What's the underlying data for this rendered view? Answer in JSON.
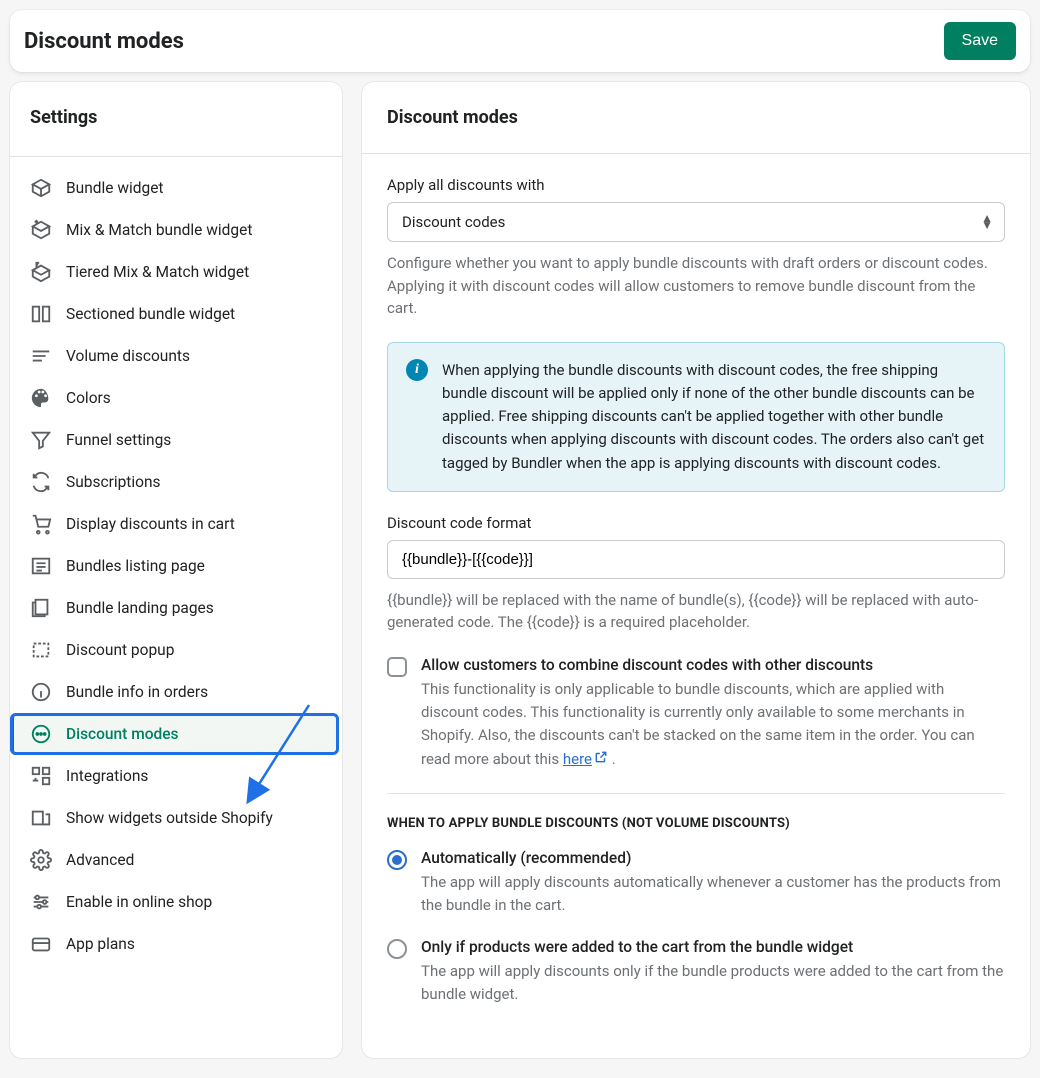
{
  "header": {
    "title": "Discount modes",
    "save": "Save"
  },
  "sidebar": {
    "title": "Settings",
    "items": [
      {
        "label": "Bundle widget"
      },
      {
        "label": "Mix & Match bundle widget"
      },
      {
        "label": "Tiered Mix & Match widget"
      },
      {
        "label": "Sectioned bundle widget"
      },
      {
        "label": "Volume discounts"
      },
      {
        "label": "Colors"
      },
      {
        "label": "Funnel settings"
      },
      {
        "label": "Subscriptions"
      },
      {
        "label": "Display discounts in cart"
      },
      {
        "label": "Bundles listing page"
      },
      {
        "label": "Bundle landing pages"
      },
      {
        "label": "Discount popup"
      },
      {
        "label": "Bundle info in orders"
      },
      {
        "label": "Discount modes"
      },
      {
        "label": "Integrations"
      },
      {
        "label": "Show widgets outside Shopify"
      },
      {
        "label": "Advanced"
      },
      {
        "label": "Enable in online shop"
      },
      {
        "label": "App plans"
      }
    ]
  },
  "main": {
    "title": "Discount modes",
    "apply_label": "Apply all discounts with",
    "apply_value": "Discount codes",
    "apply_help": "Configure whether you want to apply bundle discounts with draft orders or discount codes. Applying it with discount codes will allow customers to remove bundle discount from the cart.",
    "banner": "When applying the bundle discounts with discount codes, the free shipping bundle discount will be applied only if none of the other bundle discounts can be applied. Free shipping discounts can't be applied together with other bundle discounts when applying discounts with discount codes. The orders also can't get tagged by Bundler when the app is applying discounts with discount codes.",
    "code_format_label": "Discount code format",
    "code_format_value": "{{bundle}}-[{{code}}]",
    "code_format_help": "{{bundle}} will be replaced with the name of bundle(s), {{code}} will be replaced with auto-generated code. The {{code}} is a required placeholder.",
    "combine_label": "Allow customers to combine discount codes with other discounts",
    "combine_desc_pre": "This functionality is only applicable to bundle discounts, which are applied with discount codes. This functionality is currently only available to some merchants in Shopify. Also, the discounts can't be stacked on the same item in the order. You can read more about this ",
    "combine_link": "here",
    "combine_desc_post": " .",
    "when_heading": "When to apply bundle discounts (not volume discounts)",
    "radio1_label": "Automatically (recommended)",
    "radio1_desc": "The app will apply discounts automatically whenever a customer has the products from the bundle in the cart.",
    "radio2_label": "Only if products were added to the cart from the bundle widget",
    "radio2_desc": "The app will apply discounts only if the bundle products were added to the cart from the bundle widget."
  }
}
